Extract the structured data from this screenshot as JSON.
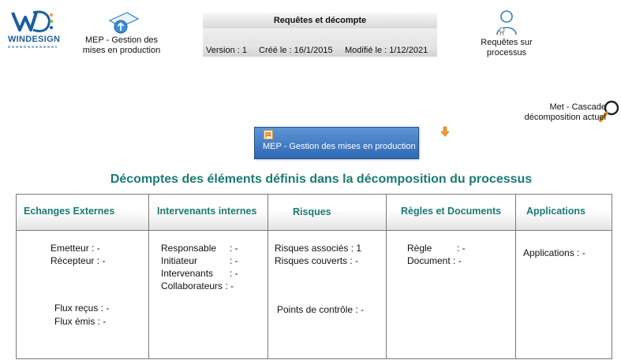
{
  "logo": {
    "wordmark": "WINDESIGN"
  },
  "nav": {
    "mep": {
      "line1": "MEP - Gestion des",
      "line2": "mises en production"
    },
    "requetes": {
      "line1": "Requêtes sur",
      "line2": "processus"
    }
  },
  "header": {
    "title": "Requêtes et décompte",
    "version": "Version : 1",
    "created": "Créé le : 16/1/2015",
    "modified": "Modifié le : 1/12/2021"
  },
  "cascade": {
    "line1": "Met -  Cascade",
    "line2": "décomposition actuel"
  },
  "mep_button": {
    "label": "MEP - Gestion des mises en production"
  },
  "section_title": "Décomptes des éléments définis dans la décomposition du processus",
  "columns": [
    {
      "header": "Echanges Externes",
      "lines": [
        "Emetteur  : -",
        "Récepteur : -",
        "Flux reçus : -",
        "Flux émis  : -"
      ]
    },
    {
      "header": "Intervenants internes",
      "lines": [
        "Responsable",
        "Initiateur",
        "Intervenants",
        "Collaborateurs : -"
      ],
      "values": [
        ": -",
        ": -",
        ": -"
      ]
    },
    {
      "header": "Risques",
      "lines": [
        "Risques associés : 1",
        "Risques couverts  : -",
        "Points de contrôle : -"
      ]
    },
    {
      "header": "Règles et Documents",
      "lines": [
        "Règle",
        "Document : -"
      ],
      "values": [
        ": -"
      ]
    },
    {
      "header": "Applications",
      "lines": [
        "Applications : -"
      ]
    }
  ],
  "colors": {
    "accent": "#1a7a72",
    "button": "#3f78c0"
  }
}
